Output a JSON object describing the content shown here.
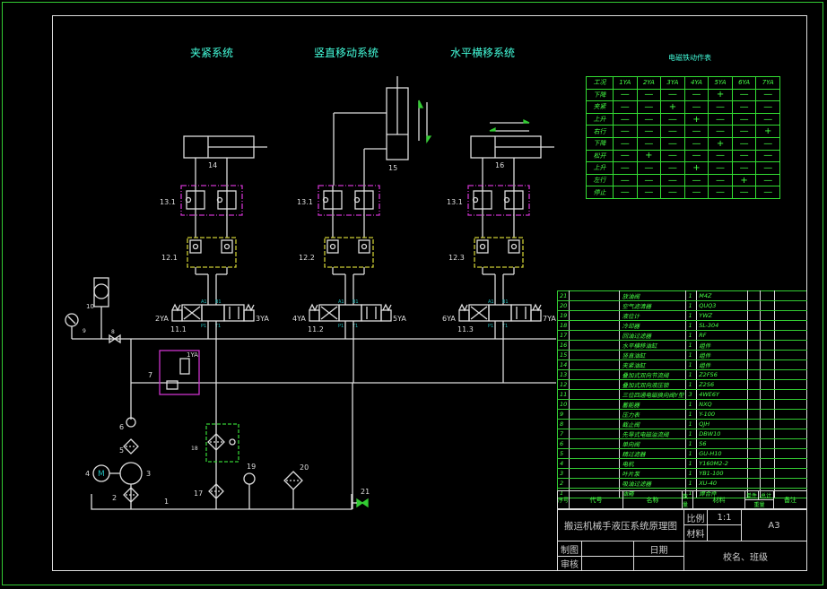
{
  "section_titles": [
    "夹紧系统",
    "竖直移动系统",
    "水平横移系统"
  ],
  "action_table": {
    "title": "电磁铁动作表",
    "headers": [
      "工况",
      "1YA",
      "2YA",
      "3YA",
      "4YA",
      "5YA",
      "6YA",
      "7YA"
    ],
    "rows": [
      [
        "下降",
        "—",
        "—",
        "—",
        "—",
        "+",
        "—",
        "—"
      ],
      [
        "夹紧",
        "—",
        "—",
        "+",
        "—",
        "—",
        "—",
        "—"
      ],
      [
        "上升",
        "—",
        "—",
        "—",
        "+",
        "—",
        "—",
        "—"
      ],
      [
        "右行",
        "—",
        "—",
        "—",
        "—",
        "—",
        "—",
        "+"
      ],
      [
        "下降",
        "—",
        "—",
        "—",
        "—",
        "+",
        "—",
        "—"
      ],
      [
        "松开",
        "—",
        "+",
        "—",
        "—",
        "—",
        "—",
        "—"
      ],
      [
        "上升",
        "—",
        "—",
        "—",
        "+",
        "—",
        "—",
        "—"
      ],
      [
        "左行",
        "—",
        "—",
        "—",
        "—",
        "—",
        "+",
        "—"
      ],
      [
        "停止",
        "—",
        "—",
        "—",
        "—",
        "—",
        "—",
        "—"
      ]
    ]
  },
  "circuits": [
    {
      "cyl": "14",
      "throttle": "13.1",
      "lock": "12.1",
      "valve": "11.1",
      "sol_left": "2YA",
      "sol_right": "3YA"
    },
    {
      "cyl": "15",
      "throttle": "13.1",
      "lock": "12.2",
      "valve": "11.2",
      "sol_left": "4YA",
      "sol_right": "5YA"
    },
    {
      "cyl": "16",
      "throttle": "13.1",
      "lock": "12.3",
      "valve": "11.3",
      "sol_left": "6YA",
      "sol_right": "7YA"
    }
  ],
  "port_labels": {
    "a": "A1",
    "b": "B1",
    "p": "P1",
    "t": "T1"
  },
  "component_labels": {
    "tank": "1",
    "suction_filter": "2",
    "pump": "3",
    "motor": "4",
    "motor_letter": "M",
    "fine_filter": "5",
    "check_valve": "6",
    "relief_valve": "7",
    "relief_sol": "1YA",
    "stop_valve": "8",
    "gauge": "9",
    "accumulator": "10",
    "cooler": "18",
    "return_filter": "17",
    "level_gauge": "19",
    "air_filter": "20",
    "drain_valve": "21"
  },
  "parts_list": [
    [
      "21",
      "",
      "放油阀",
      "1",
      "M4Z"
    ],
    [
      "20",
      "",
      "空气滤清器",
      "1",
      "QUQ3"
    ],
    [
      "19",
      "",
      "液位计",
      "1",
      "YWZ"
    ],
    [
      "18",
      "",
      "冷却器",
      "1",
      "SL-304"
    ],
    [
      "17",
      "",
      "回油过滤器",
      "1",
      "RF"
    ],
    [
      "16",
      "",
      "水平横移油缸",
      "1",
      "组件"
    ],
    [
      "15",
      "",
      "竖直油缸",
      "1",
      "组件"
    ],
    [
      "14",
      "",
      "夹紧油缸",
      "1",
      "组件"
    ],
    [
      "13",
      "",
      "叠加式双向节流阀",
      "1",
      "Z2FS6"
    ],
    [
      "12",
      "",
      "叠加式双向液压锁",
      "1",
      "Z2S6"
    ],
    [
      "11",
      "",
      "三位四通电磁换向阀Y型",
      "3",
      "4WE6Y"
    ],
    [
      "10",
      "",
      "蓄能器",
      "1",
      "NXQ"
    ],
    [
      "9",
      "",
      "压力表",
      "1",
      "Y-100"
    ],
    [
      "8",
      "",
      "截止阀",
      "1",
      "QJH"
    ],
    [
      "7",
      "",
      "先导式电磁溢流阀",
      "1",
      "DBW10"
    ],
    [
      "6",
      "",
      "单向阀",
      "1",
      "S6"
    ],
    [
      "5",
      "",
      "精过滤器",
      "1",
      "GU-H10"
    ],
    [
      "4",
      "",
      "电机",
      "1",
      "Y160M2-2"
    ],
    [
      "3",
      "",
      "叶片泵",
      "1",
      "YB1-100"
    ],
    [
      "2",
      "",
      "吸油过滤器",
      "1",
      "XU-40"
    ],
    [
      "1",
      "",
      "油箱",
      "1",
      "焊合件"
    ]
  ],
  "parts_header": {
    "no": "序号",
    "code": "代号",
    "name": "名称",
    "qty": "数量",
    "material": "材料",
    "unit": "单件",
    "total": "总计",
    "weight": "重量",
    "remark": "备注"
  },
  "title_block": {
    "drawing_title": "搬运机械手液压系统原理图",
    "scale_label": "比例",
    "scale": "1:1",
    "material_label": "材料",
    "size": "A3",
    "drawn_label": "制图",
    "date_label": "日期",
    "checked_label": "审核",
    "school": "校名、班级"
  }
}
